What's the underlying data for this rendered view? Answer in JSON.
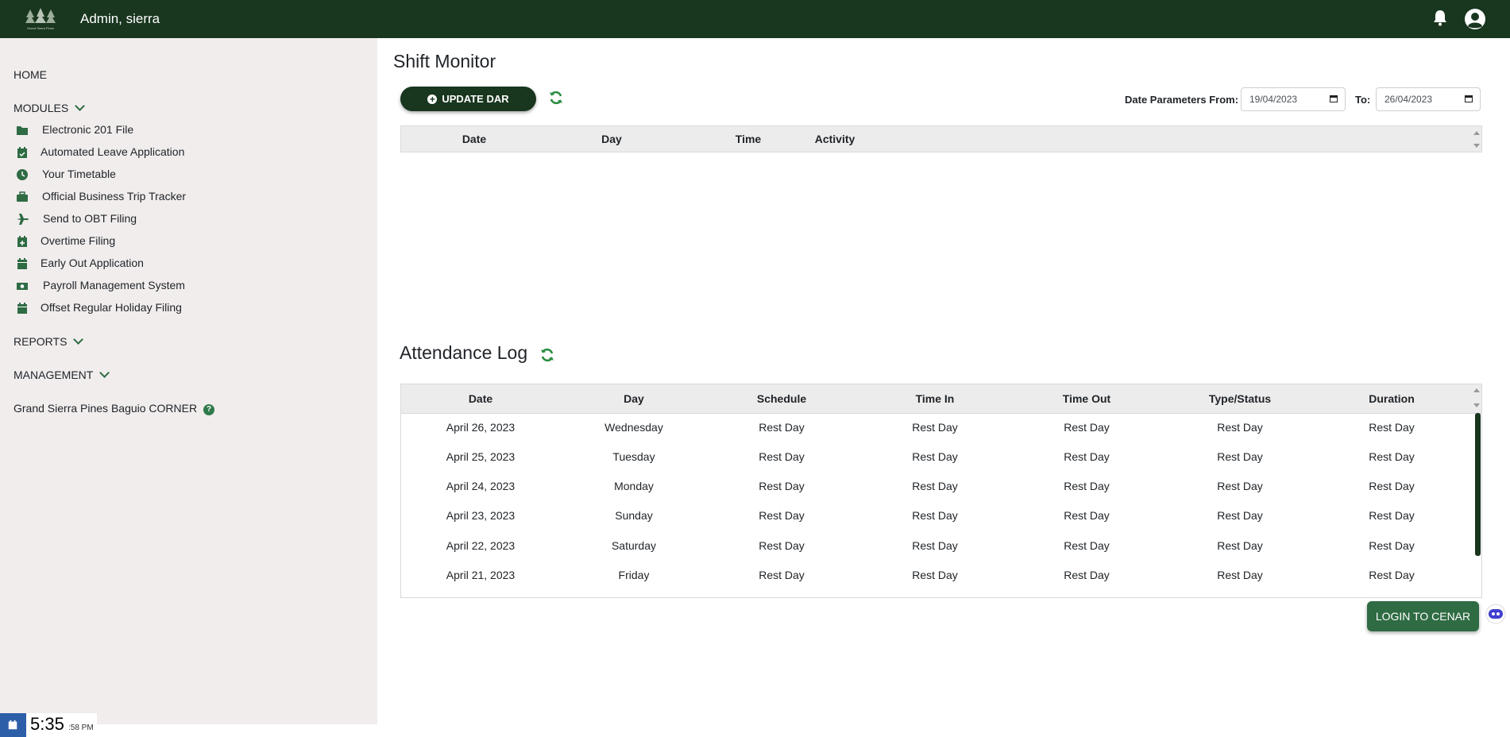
{
  "header": {
    "title": "Admin, sierra",
    "logo_text": "Grand Sierra Pines",
    "bell_icon": "bell-icon",
    "avatar_icon": "user-avatar-icon",
    "bg_color": "#19361f"
  },
  "sidebar": {
    "home": "HOME",
    "modules": "MODULES",
    "module_items": [
      {
        "label": "Electronic 201 File",
        "icon": "folder-icon"
      },
      {
        "label": "Automated Leave Application",
        "icon": "calendar-check-icon"
      },
      {
        "label": "Your Timetable",
        "icon": "clock-icon"
      },
      {
        "label": "Official Business Trip Tracker",
        "icon": "briefcase-icon"
      },
      {
        "label": "Send to OBT Filing",
        "icon": "plane-icon"
      },
      {
        "label": "Overtime Filing",
        "icon": "calendar-plus-icon"
      },
      {
        "label": "Early Out Application",
        "icon": "calendar-icon"
      },
      {
        "label": "Payroll Management System",
        "icon": "money-bill-icon"
      },
      {
        "label": "Offset Regular Holiday Filing",
        "icon": "calendar-icon"
      }
    ],
    "reports": "REPORTS",
    "management": "MANAGEMENT",
    "branch": "Grand Sierra Pines Baguio CORNER"
  },
  "shift_monitor": {
    "title": "Shift Monitor",
    "update_button": "UPDATE DAR",
    "date_from_label": "Date Parameters From:",
    "date_from": "19/04/2023",
    "date_to_label": "To:",
    "date_to": "26/04/2023",
    "columns": [
      "Date",
      "Day",
      "Time",
      "Activity"
    ]
  },
  "attendance": {
    "title": "Attendance Log",
    "columns": [
      "Date",
      "Day",
      "Schedule",
      "Time In",
      "Time Out",
      "Type/Status",
      "Duration"
    ],
    "rows": [
      [
        "April 26, 2023",
        "Wednesday",
        "Rest Day",
        "Rest Day",
        "Rest Day",
        "Rest Day",
        "Rest Day"
      ],
      [
        "April 25, 2023",
        "Tuesday",
        "Rest Day",
        "Rest Day",
        "Rest Day",
        "Rest Day",
        "Rest Day"
      ],
      [
        "April 24, 2023",
        "Monday",
        "Rest Day",
        "Rest Day",
        "Rest Day",
        "Rest Day",
        "Rest Day"
      ],
      [
        "April 23, 2023",
        "Sunday",
        "Rest Day",
        "Rest Day",
        "Rest Day",
        "Rest Day",
        "Rest Day"
      ],
      [
        "April 22, 2023",
        "Saturday",
        "Rest Day",
        "Rest Day",
        "Rest Day",
        "Rest Day",
        "Rest Day"
      ],
      [
        "April 21, 2023",
        "Friday",
        "Rest Day",
        "Rest Day",
        "Rest Day",
        "Rest Day",
        "Rest Day"
      ]
    ]
  },
  "login_cenar": "LOGIN TO CENAR",
  "clock": {
    "time": "5:35",
    "seconds": ":58 PM"
  }
}
